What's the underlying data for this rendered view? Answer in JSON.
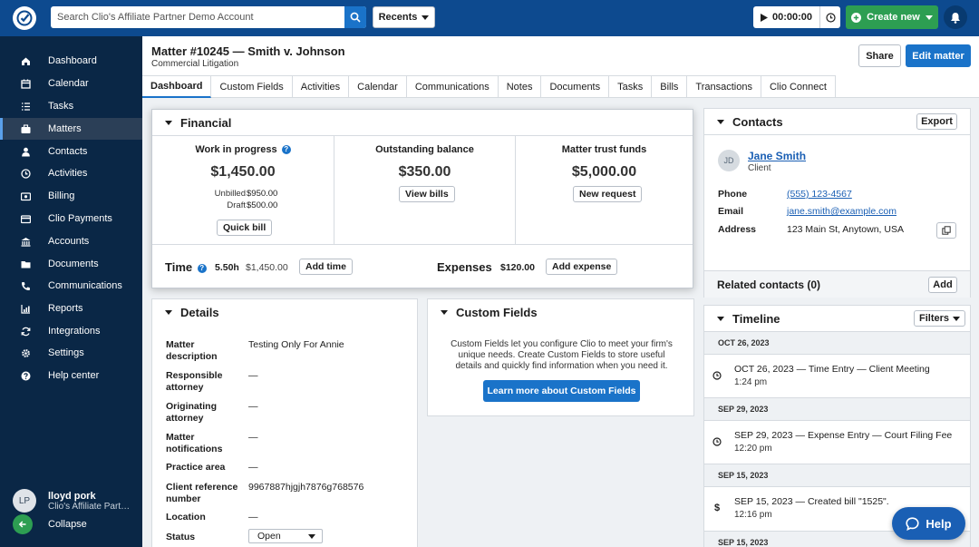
{
  "topbar": {
    "search_placeholder": "Search Clio's Affiliate Partner Demo Account",
    "recents_label": "Recents",
    "timer_value": "00:00:00",
    "create_label": "Create new"
  },
  "sidebar": {
    "items": [
      {
        "label": "Dashboard",
        "icon": "home-icon"
      },
      {
        "label": "Calendar",
        "icon": "calendar-icon"
      },
      {
        "label": "Tasks",
        "icon": "tasks-icon"
      },
      {
        "label": "Matters",
        "icon": "briefcase-icon",
        "active": true
      },
      {
        "label": "Contacts",
        "icon": "person-icon"
      },
      {
        "label": "Activities",
        "icon": "clock-icon"
      },
      {
        "label": "Billing",
        "icon": "billing-icon"
      },
      {
        "label": "Clio Payments",
        "icon": "card-icon"
      },
      {
        "label": "Accounts",
        "icon": "bank-icon"
      },
      {
        "label": "Documents",
        "icon": "folder-icon"
      },
      {
        "label": "Communications",
        "icon": "phone-icon"
      },
      {
        "label": "Reports",
        "icon": "chart-icon"
      },
      {
        "label": "Integrations",
        "icon": "sync-icon"
      },
      {
        "label": "Settings",
        "icon": "gear-icon"
      },
      {
        "label": "Help center",
        "icon": "help-icon"
      }
    ],
    "user": {
      "initials": "LP",
      "name": "lloyd pork",
      "firm": "Clio's Affiliate Partner Demo Account"
    },
    "collapse_label": "Collapse"
  },
  "header": {
    "title": "Matter #10245 — Smith v. Johnson",
    "subtitle": "Commercial Litigation",
    "share_label": "Share",
    "edit_label": "Edit matter"
  },
  "tabs": [
    "Dashboard",
    "Custom Fields",
    "Activities",
    "Calendar",
    "Communications",
    "Notes",
    "Documents",
    "Tasks",
    "Bills",
    "Transactions",
    "Clio Connect"
  ],
  "financial": {
    "title": "Financial",
    "wip": {
      "label": "Work in progress",
      "amount": "$1,450.00",
      "unbilled_label": "Unbilled",
      "unbilled": "$950.00",
      "draft_label": "Draft",
      "draft": "$500.00",
      "button": "Quick bill"
    },
    "outstanding": {
      "label": "Outstanding balance",
      "amount": "$350.00",
      "button": "View bills"
    },
    "trust": {
      "label": "Matter trust funds",
      "amount": "$5,000.00",
      "button": "New request"
    },
    "time": {
      "label": "Time",
      "hours": "5.50h",
      "amount": "$1,450.00",
      "button": "Add time"
    },
    "expenses": {
      "label": "Expenses",
      "amount": "$120.00",
      "button": "Add expense"
    }
  },
  "details": {
    "title": "Details",
    "rows": [
      {
        "label": "Matter description",
        "value": "Testing Only For Annie"
      },
      {
        "label": "Responsible attorney",
        "value": "—"
      },
      {
        "label": "Originating attorney",
        "value": "—"
      },
      {
        "label": "Matter notifications",
        "value": "—"
      },
      {
        "label": "Practice area",
        "value": "—"
      },
      {
        "label": "Client reference number",
        "value": "9967887hjgjh7876g768576"
      },
      {
        "label": "Location",
        "value": "—"
      }
    ],
    "status_label": "Status",
    "status_value": "Open"
  },
  "custom_fields": {
    "title": "Custom Fields",
    "text": "Custom Fields let you configure Clio to meet your firm's unique needs. Create Custom Fields to store useful details and quickly find information when you need it.",
    "button": "Learn more about Custom Fields"
  },
  "contacts": {
    "title": "Contacts",
    "export_label": "Export",
    "contact": {
      "initials": "JD",
      "name": "Jane Smith",
      "role": "Client"
    },
    "phone_label": "Phone",
    "phone": "(555) 123-4567",
    "email_label": "Email",
    "email": "jane.smith@example.com",
    "address_label": "Address",
    "address": "123 Main St, Anytown, USA",
    "related_label": "Related contacts (0)",
    "add_label": "Add"
  },
  "timeline": {
    "title": "Timeline",
    "filters_label": "Filters",
    "dates": [
      "OCT 26, 2023",
      "SEP 29, 2023",
      "SEP 15, 2023",
      "SEP 15, 2023"
    ],
    "entries": [
      {
        "title": "OCT 26, 2023 — Time Entry — Client Meeting",
        "time": "1:24 pm",
        "icon": "clock-icon"
      },
      {
        "title": "SEP 29, 2023 — Expense Entry — Court Filing Fee",
        "time": "12:20 pm",
        "icon": "clock-icon"
      },
      {
        "title": "SEP 15, 2023 — Created bill \"1525\".",
        "time": "12:16 pm",
        "icon": "dollar-icon"
      }
    ]
  },
  "help_label": "Help",
  "colors": {
    "brand_blue": "#0d4a8f",
    "sidebar_bg": "#0a2746",
    "primary": "#1a73c9",
    "create_green": "#2d9e52"
  }
}
